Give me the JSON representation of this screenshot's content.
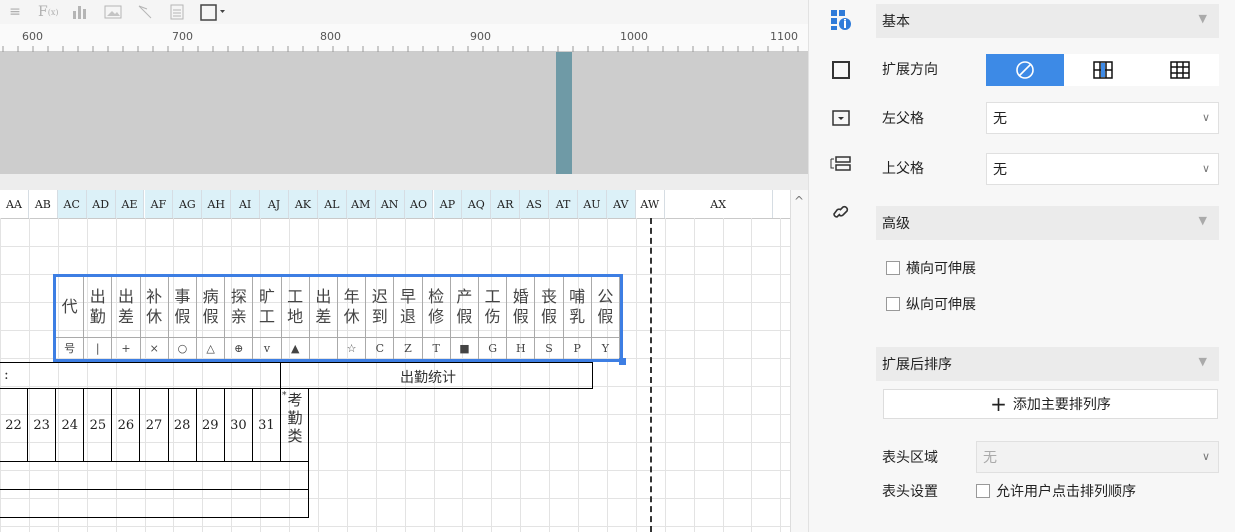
{
  "editor": {
    "ruler_labels": [
      "600",
      "700",
      "800",
      "900",
      "1000",
      "1100"
    ],
    "columns": [
      "AA",
      "AB",
      "AC",
      "AD",
      "AE",
      "AF",
      "AG",
      "AH",
      "AI",
      "AJ",
      "AK",
      "AL",
      "AM",
      "AN",
      "AO",
      "AP",
      "AQ",
      "AR",
      "AS",
      "AT",
      "AU",
      "AV",
      "AW",
      "AX"
    ],
    "highlighted_columns": [
      "AC",
      "AD",
      "AE",
      "AF",
      "AG",
      "AH",
      "AI",
      "AJ",
      "AK",
      "AL",
      "AM",
      "AN",
      "AO",
      "AP",
      "AQ",
      "AR",
      "AS",
      "AT",
      "AU",
      "AV"
    ],
    "legend": {
      "names": [
        "代",
        "出勤",
        "出差",
        "补休",
        "事假",
        "病假",
        "探亲",
        "旷工",
        "工地",
        "出差",
        "年休",
        "迟到",
        "早退",
        "检修",
        "产假",
        "工伤",
        "婚假",
        "丧假",
        "哺乳",
        "公假"
      ],
      "symbols": [
        "号",
        "|",
        "+",
        "×",
        "○",
        "△",
        "⊕",
        "v",
        "▲",
        "",
        "☆",
        "C",
        "Z",
        "T",
        "■",
        "G",
        "H",
        "S",
        "P",
        "Y"
      ]
    },
    "stat_colon": ":",
    "stat_label": "出勤统计",
    "days": [
      "22",
      "23",
      "24",
      "25",
      "26",
      "27",
      "28",
      "29",
      "30",
      "31"
    ],
    "attend_type": "考勤类",
    "attend_mark": "*"
  },
  "panel": {
    "basic": {
      "title": "基本"
    },
    "expand_direction_label": "扩展方向",
    "left_parent_label": "左父格",
    "left_parent_value": "无",
    "top_parent_label": "上父格",
    "top_parent_value": "无",
    "advanced": {
      "title": "高级"
    },
    "horizontal_expand": "横向可伸展",
    "vertical_expand": "纵向可伸展",
    "sort": {
      "title": "扩展后排序"
    },
    "add_sort_button": "添加主要排列序",
    "header_area_label": "表头区域",
    "header_area_value": "无",
    "header_setting_label": "表头设置",
    "allow_sort_label": "允许用户点击排列顺序"
  },
  "colors": {
    "accent": "#3d8ae6",
    "selection": "#3d7ee3",
    "column_highlight": "#dcf1f8"
  }
}
